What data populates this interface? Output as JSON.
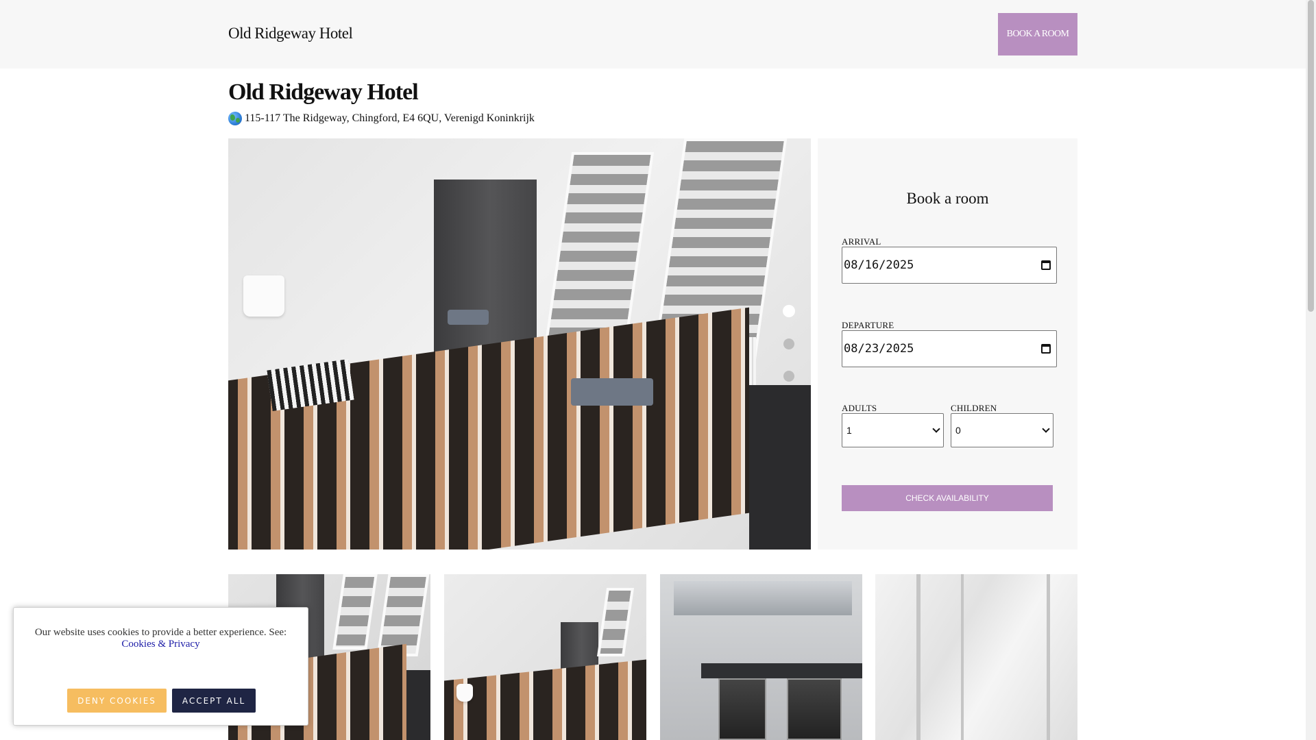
{
  "header": {
    "brand": "Old Ridgeway Hotel",
    "book_button": "BOOK A ROOM"
  },
  "hotel": {
    "name": "Old Ridgeway Hotel",
    "address": "115-117 The Ridgeway, Chingford, E4 6QU, Verenigd Koninkrijk",
    "address_icon": "globe-icon"
  },
  "gallery": {
    "active_slide": 1,
    "slide_count": 3,
    "colors": {
      "dot_active": "#ffffff",
      "dot_inactive": "#bdbdbd"
    }
  },
  "booking": {
    "title": "Book a room",
    "arrival_label": "ARRIVAL",
    "arrival_value": "08/16/2025",
    "departure_label": "DEPARTURE",
    "departure_value": "08/23/2025",
    "adults_label": "ADULTS",
    "adults_value": "1",
    "children_label": "CHILDREN",
    "children_value": "0",
    "check_button": "CHECK AVAILABILITY"
  },
  "cookie_banner": {
    "text": "Our website uses cookies to provide a better experience. See:",
    "link": "Cookies & Privacy",
    "deny_button": "DENY COOKIES",
    "accept_button": "ACCEPT ALL"
  },
  "colors": {
    "accent": "#b88fc0",
    "deny": "#f6bd60",
    "accept": "#1f2544"
  }
}
